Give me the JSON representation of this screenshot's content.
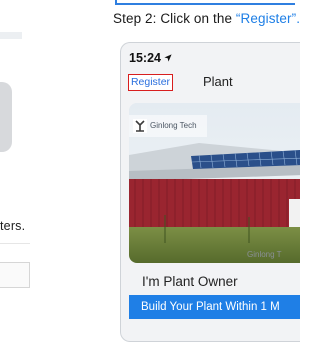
{
  "left_panel": {
    "visible_text": "ters."
  },
  "instruction": {
    "prefix": "Step 2: Click on the ",
    "open_quote": "“",
    "highlight": "Register",
    "close_quote": "”."
  },
  "phone": {
    "status_time": "15:24",
    "register_button": "Register",
    "nav_title": "Plant",
    "banner": {
      "brand_text": "Ginlong Tech",
      "caption": "Ginlong T"
    },
    "owner_heading": "I'm Plant Owner",
    "cta_label": "Build Your Plant Within 1 M"
  },
  "colors": {
    "accent_blue": "#1f7fe6",
    "highlight_red": "#d81e1e",
    "barn_red": "#9a2530"
  }
}
